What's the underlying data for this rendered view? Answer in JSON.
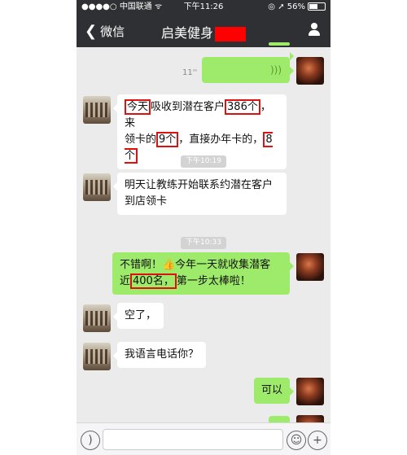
{
  "status_bar": {
    "carrier": "中国联通",
    "time": "下午11:26",
    "battery": "56%"
  },
  "nav": {
    "back_label": "微信",
    "title": "启美健身"
  },
  "messages": {
    "voice_duration": "11''",
    "m1_a": "今天",
    "m1_b": "吸收到潜在客户",
    "m1_c": "386个",
    "m1_d": "，来",
    "m1_e": "领卡的",
    "m1_f": "9个",
    "m1_g": "，直接办年卡的，",
    "m1_h": "8个",
    "ts1": "下午10:19",
    "m2": "明天让教练开始联系约潜在客户到店领卡",
    "ts2": "下午10:33",
    "m3_a": "不错啊！👍今年一天就收集潜客",
    "m3_b": "近",
    "m3_c": "400名，",
    "m3_d": "第一步太棒啦！",
    "m4": "空了，",
    "m5": "我语言电话你？",
    "m6": "可以"
  },
  "colors": {
    "self_bubble": "#9eea6a",
    "highlight_box": "#e01010",
    "header": "#2f3033"
  }
}
